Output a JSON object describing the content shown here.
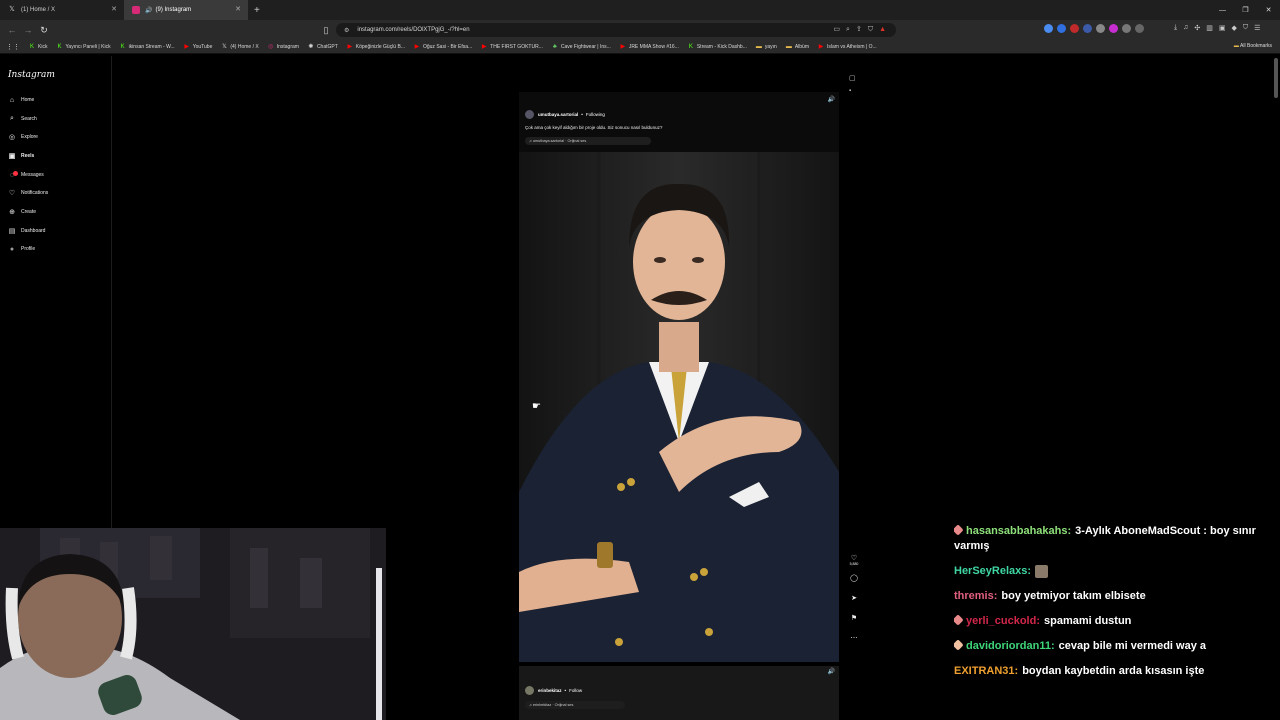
{
  "browser": {
    "tabs": [
      {
        "title": "(1) Home / X",
        "icon": "x-logo-icon"
      },
      {
        "title": "(9) Instagram",
        "icon": "instagram-icon"
      }
    ],
    "url": "instagram.com/reels/DOlXTPgjG_-/?hl=en",
    "bookmarks": [
      "Kick",
      "Yayıncı Paneli | Kick",
      "ikinsan Stream - W...",
      "YouTube",
      "(4) Home / X",
      "Instagram",
      "ChatGPT",
      "Köpeğinizle Güçlü B...",
      "Oğuz Sasi - Bir Efsa...",
      "THE FIRST GOKTUR...",
      "Cave Fightwear | Ins...",
      "JRE MMA Show #16...",
      "Stream - Kick Dashb...",
      "yayın",
      "Albüm",
      "Islam vs Atheism | O..."
    ],
    "all_bookmarks": "All Bookmarks"
  },
  "sidebar": {
    "logo": "Instagram",
    "items": [
      {
        "label": "Home",
        "icon": "home-icon"
      },
      {
        "label": "Search",
        "icon": "search-icon"
      },
      {
        "label": "Explore",
        "icon": "compass-icon"
      },
      {
        "label": "Reels",
        "icon": "reels-icon"
      },
      {
        "label": "Messages",
        "icon": "messenger-icon"
      },
      {
        "label": "Notifications",
        "icon": "heart-icon"
      },
      {
        "label": "Create",
        "icon": "plus-icon"
      },
      {
        "label": "Dashboard",
        "icon": "dashboard-icon"
      },
      {
        "label": "Profile",
        "icon": "avatar-icon"
      }
    ]
  },
  "reel": {
    "username": "umutbaya.sartorial",
    "follow_state": "Following",
    "caption": "Çok ama çok keyif aldığım bir proje oldu. Siz sonucu nasıl buldunuz?",
    "audio": "umutbaya.sartorial · Orijinal ses",
    "likes": "5,880"
  },
  "reel_next": {
    "username": "erinbekitaz",
    "follow_label": "Follow",
    "audio": "erinbekitaz · Orijinal ses"
  },
  "chat": {
    "messages": [
      {
        "user": "hasansabbahakahs:",
        "text": "3-Aylık AboneMadScout : boy sınır varmış",
        "color": "#8ee07a",
        "badge": true
      },
      {
        "user": "HerSeyRelaxs:",
        "text": "",
        "color": "#3fd6a4",
        "badge": false,
        "emote": true
      },
      {
        "user": "thremis:",
        "text": "boy yetmiyor takım elbisete",
        "color": "#e0607e",
        "badge": false
      },
      {
        "user": "yerli_cuckold:",
        "text": "spamami dustun",
        "color": "#d2264a",
        "badge": true
      },
      {
        "user": "davidoriordan11:",
        "text": "cevap bile mi vermedi way a",
        "color": "#3fd67a",
        "badge": true
      },
      {
        "user": "EXITRAN31:",
        "text": "boydan kaybetdin arda kısasın işte",
        "color": "#f0a030",
        "badge": false
      }
    ]
  }
}
